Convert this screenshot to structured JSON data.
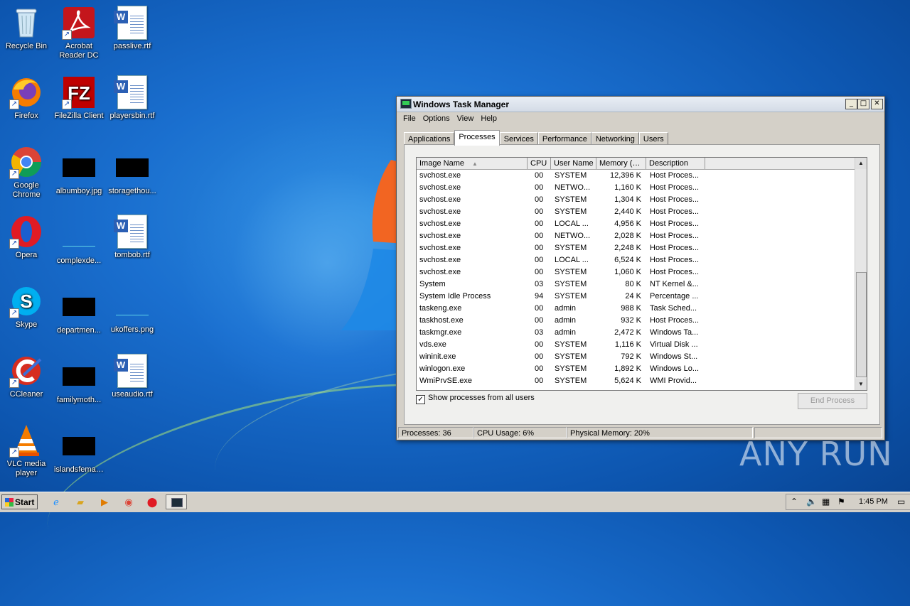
{
  "desktop": {
    "icons": [
      {
        "label": "Recycle Bin"
      },
      {
        "label": "Acrobat Reader DC"
      },
      {
        "label": "passlive.rtf"
      },
      {
        "label": "Firefox"
      },
      {
        "label": "FileZilla Client"
      },
      {
        "label": "playersbin.rtf"
      },
      {
        "label": "Google Chrome"
      },
      {
        "label": "albumboy.jpg"
      },
      {
        "label": "storagethou..."
      },
      {
        "label": "Opera"
      },
      {
        "label": "complexde..."
      },
      {
        "label": "tombob.rtf"
      },
      {
        "label": "Skype"
      },
      {
        "label": "departmen..."
      },
      {
        "label": "ukoffers.png"
      },
      {
        "label": "CCleaner"
      },
      {
        "label": "familymoth..."
      },
      {
        "label": "useaudio.rtf"
      },
      {
        "label": "VLC media player"
      },
      {
        "label": "islandsfemal..."
      }
    ]
  },
  "window": {
    "title": "Windows Task Manager",
    "menu": [
      "File",
      "Options",
      "View",
      "Help"
    ],
    "tabs": [
      "Applications",
      "Processes",
      "Services",
      "Performance",
      "Networking",
      "Users"
    ],
    "columns": [
      "Image Name",
      "CPU",
      "User Name",
      "Memory (…",
      "Description"
    ],
    "rows": [
      {
        "name": "svchost.exe",
        "cpu": "00",
        "user": "SYSTEM",
        "mem": "12,396 K",
        "desc": "Host Proces..."
      },
      {
        "name": "svchost.exe",
        "cpu": "00",
        "user": "NETWO...",
        "mem": "1,160 K",
        "desc": "Host Proces..."
      },
      {
        "name": "svchost.exe",
        "cpu": "00",
        "user": "SYSTEM",
        "mem": "1,304 K",
        "desc": "Host Proces..."
      },
      {
        "name": "svchost.exe",
        "cpu": "00",
        "user": "SYSTEM",
        "mem": "2,440 K",
        "desc": "Host Proces..."
      },
      {
        "name": "svchost.exe",
        "cpu": "00",
        "user": "LOCAL ...",
        "mem": "4,956 K",
        "desc": "Host Proces..."
      },
      {
        "name": "svchost.exe",
        "cpu": "00",
        "user": "NETWO...",
        "mem": "2,028 K",
        "desc": "Host Proces..."
      },
      {
        "name": "svchost.exe",
        "cpu": "00",
        "user": "SYSTEM",
        "mem": "2,248 K",
        "desc": "Host Proces..."
      },
      {
        "name": "svchost.exe",
        "cpu": "00",
        "user": "LOCAL ...",
        "mem": "6,524 K",
        "desc": "Host Proces..."
      },
      {
        "name": "svchost.exe",
        "cpu": "00",
        "user": "SYSTEM",
        "mem": "1,060 K",
        "desc": "Host Proces..."
      },
      {
        "name": "System",
        "cpu": "03",
        "user": "SYSTEM",
        "mem": "80 K",
        "desc": "NT Kernel &..."
      },
      {
        "name": "System Idle Process",
        "cpu": "94",
        "user": "SYSTEM",
        "mem": "24 K",
        "desc": "Percentage ..."
      },
      {
        "name": "taskeng.exe",
        "cpu": "00",
        "user": "admin",
        "mem": "988 K",
        "desc": "Task Sched..."
      },
      {
        "name": "taskhost.exe",
        "cpu": "00",
        "user": "admin",
        "mem": "932 K",
        "desc": "Host Proces..."
      },
      {
        "name": "taskmgr.exe",
        "cpu": "03",
        "user": "admin",
        "mem": "2,472 K",
        "desc": "Windows Ta..."
      },
      {
        "name": "vds.exe",
        "cpu": "00",
        "user": "SYSTEM",
        "mem": "1,116 K",
        "desc": "Virtual Disk ..."
      },
      {
        "name": "wininit.exe",
        "cpu": "00",
        "user": "SYSTEM",
        "mem": "792 K",
        "desc": "Windows St..."
      },
      {
        "name": "winlogon.exe",
        "cpu": "00",
        "user": "SYSTEM",
        "mem": "1,892 K",
        "desc": "Windows Lo..."
      },
      {
        "name": "WmiPrvSE.exe",
        "cpu": "00",
        "user": "SYSTEM",
        "mem": "5,624 K",
        "desc": "WMI Provid..."
      }
    ],
    "show_all_label": "Show processes from all users",
    "end_process": "End Process",
    "status": {
      "processes": "Processes: 36",
      "cpu": "CPU Usage: 6%",
      "memory": "Physical Memory: 20%"
    }
  },
  "taskbar": {
    "start": "Start",
    "clock": "1:45 PM"
  },
  "watermark": "ANY RUN"
}
